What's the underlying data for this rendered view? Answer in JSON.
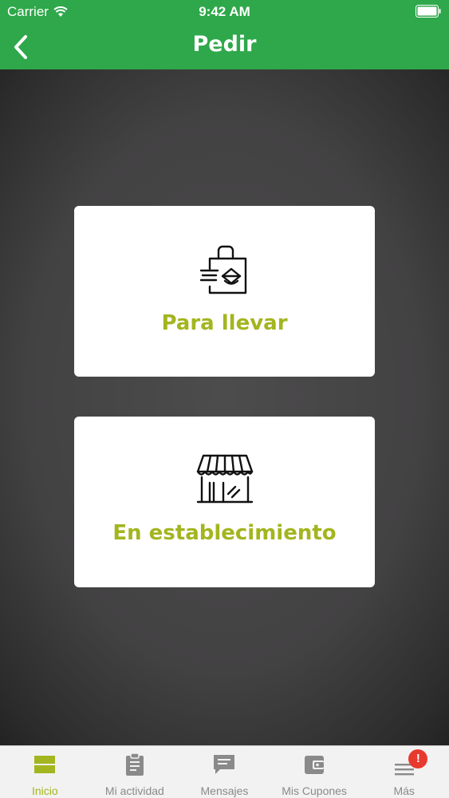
{
  "status_bar": {
    "carrier": "Carrier",
    "time": "9:42 AM"
  },
  "nav": {
    "title": "Pedir",
    "back_icon": "chevron-left-icon"
  },
  "options": [
    {
      "label": "Para llevar",
      "icon": "takeaway-bag-icon"
    },
    {
      "label": "En establecimiento",
      "icon": "storefront-icon"
    }
  ],
  "tabs": [
    {
      "label": "Inicio",
      "icon": "home-grid-icon",
      "active": true
    },
    {
      "label": "Mi actividad",
      "icon": "clipboard-icon",
      "active": false
    },
    {
      "label": "Mensajes",
      "icon": "message-icon",
      "active": false
    },
    {
      "label": "Mis Cupones",
      "icon": "wallet-icon",
      "active": false
    },
    {
      "label": "Más",
      "icon": "menu-icon",
      "active": false,
      "badge": "!"
    }
  ],
  "colors": {
    "header_green": "#2ea84a",
    "accent_olive": "#a3b51f",
    "badge_red": "#e8392f"
  }
}
